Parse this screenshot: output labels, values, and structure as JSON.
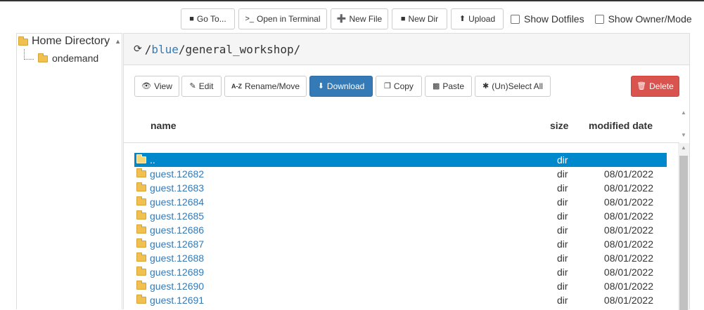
{
  "toolbar": {
    "goto": "Go To...",
    "terminal": "Open in Terminal",
    "new_file": "New File",
    "new_dir": "New Dir",
    "upload": "Upload",
    "show_dotfiles": "Show Dotfiles",
    "show_owner_mode": "Show Owner/Mode"
  },
  "tree": {
    "root": "Home Directory",
    "child": "ondemand"
  },
  "path": {
    "segments": [
      "blue",
      "general_workshop"
    ]
  },
  "actions": {
    "view": "View",
    "edit": "Edit",
    "rename": "Rename/Move",
    "download": "Download",
    "copy": "Copy",
    "paste": "Paste",
    "select_all": "(Un)Select All",
    "delete": "Delete"
  },
  "table": {
    "headers": {
      "name": "name",
      "size": "size",
      "modified": "modified date"
    },
    "rows": [
      {
        "name": "..",
        "size": "dir",
        "date": ""
      },
      {
        "name": "guest.12682",
        "size": "dir",
        "date": "08/01/2022"
      },
      {
        "name": "guest.12683",
        "size": "dir",
        "date": "08/01/2022"
      },
      {
        "name": "guest.12684",
        "size": "dir",
        "date": "08/01/2022"
      },
      {
        "name": "guest.12685",
        "size": "dir",
        "date": "08/01/2022"
      },
      {
        "name": "guest.12686",
        "size": "dir",
        "date": "08/01/2022"
      },
      {
        "name": "guest.12687",
        "size": "dir",
        "date": "08/01/2022"
      },
      {
        "name": "guest.12688",
        "size": "dir",
        "date": "08/01/2022"
      },
      {
        "name": "guest.12689",
        "size": "dir",
        "date": "08/01/2022"
      },
      {
        "name": "guest.12690",
        "size": "dir",
        "date": "08/01/2022"
      },
      {
        "name": "guest.12691",
        "size": "dir",
        "date": "08/01/2022"
      }
    ]
  },
  "colors": {
    "primary": "#337ab7",
    "danger": "#d9534f",
    "selected_row": "#0088cc",
    "folder": "#f0c050"
  }
}
